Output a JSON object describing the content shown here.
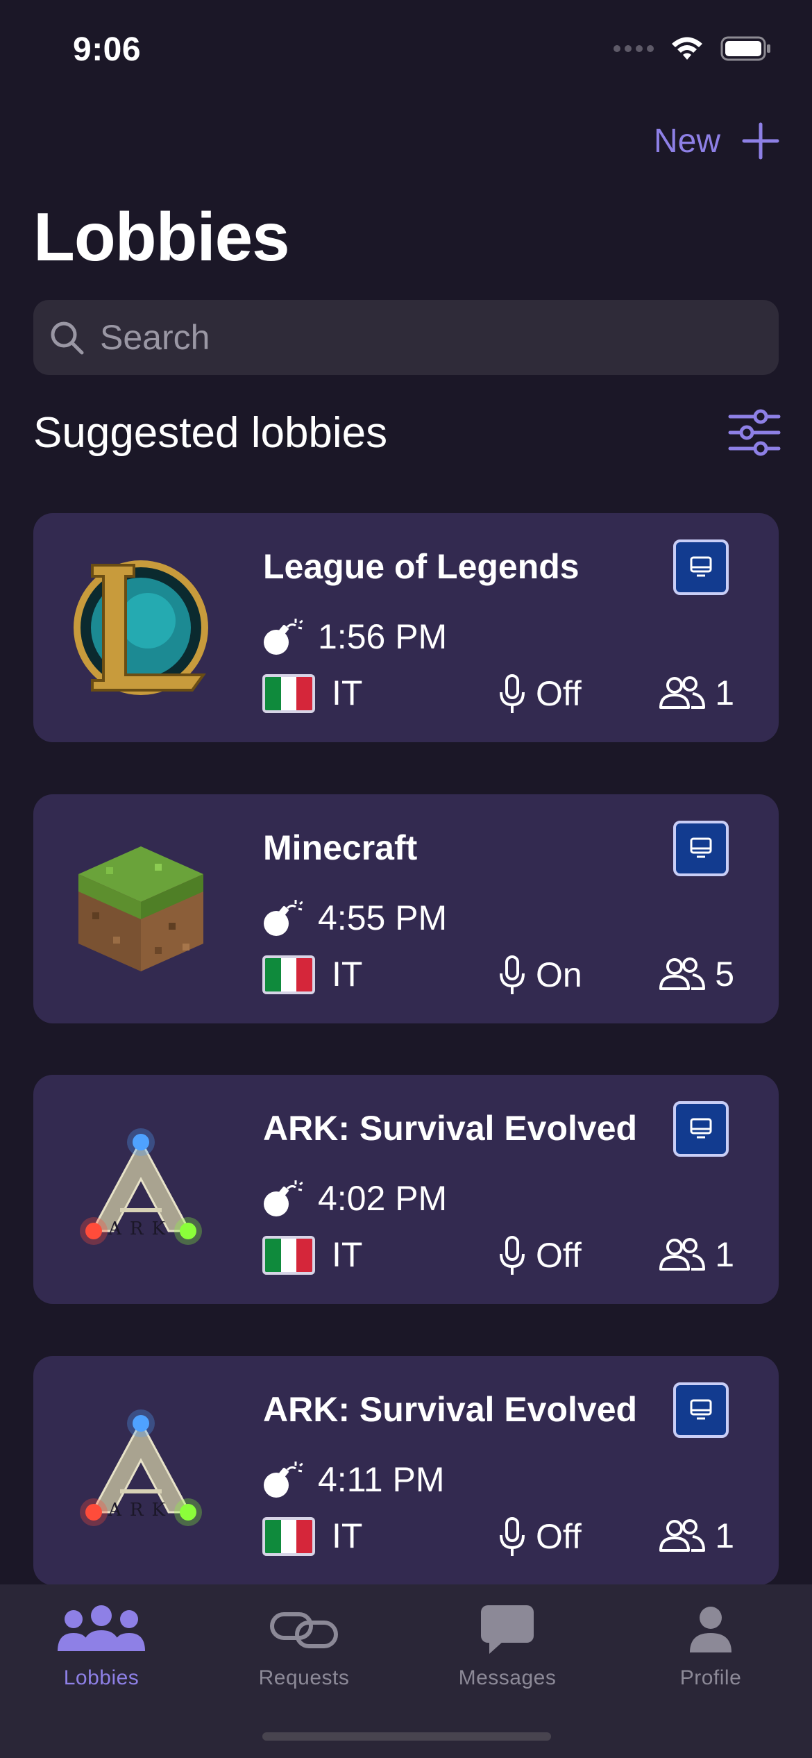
{
  "status_bar": {
    "time": "9:06"
  },
  "header": {
    "new_label": "New",
    "title": "Lobbies"
  },
  "search": {
    "placeholder": "Search"
  },
  "section": {
    "title": "Suggested lobbies"
  },
  "lobbies": [
    {
      "game": "League of Legends",
      "art_icon": "league-of-legends-logo",
      "time": "1:56 PM",
      "country": "IT",
      "mic": "Off",
      "players": "1",
      "platform_icon": "pc-icon"
    },
    {
      "game": "Minecraft",
      "art_icon": "minecraft-grass-block",
      "time": "4:55 PM",
      "country": "IT",
      "mic": "On",
      "players": "5",
      "platform_icon": "pc-icon"
    },
    {
      "game": "ARK: Survival Evolved",
      "art_icon": "ark-logo",
      "time": "4:02 PM",
      "country": "IT",
      "mic": "Off",
      "players": "1",
      "platform_icon": "pc-icon"
    },
    {
      "game": "ARK: Survival Evolved",
      "art_icon": "ark-logo",
      "time": "4:11 PM",
      "country": "IT",
      "mic": "Off",
      "players": "1",
      "platform_icon": "pc-icon"
    }
  ],
  "tabs": [
    {
      "label": "Lobbies",
      "icon": "people-icon",
      "active": true
    },
    {
      "label": "Requests",
      "icon": "link-icon",
      "active": false
    },
    {
      "label": "Messages",
      "icon": "chat-bubble-icon",
      "active": false
    },
    {
      "label": "Profile",
      "icon": "person-icon",
      "active": false
    }
  ],
  "colors": {
    "background": "#1b1727",
    "card": "#332a50",
    "accent": "#8e80e6",
    "platform_badge": "#123b8f",
    "tab_bar": "#2a2637"
  }
}
